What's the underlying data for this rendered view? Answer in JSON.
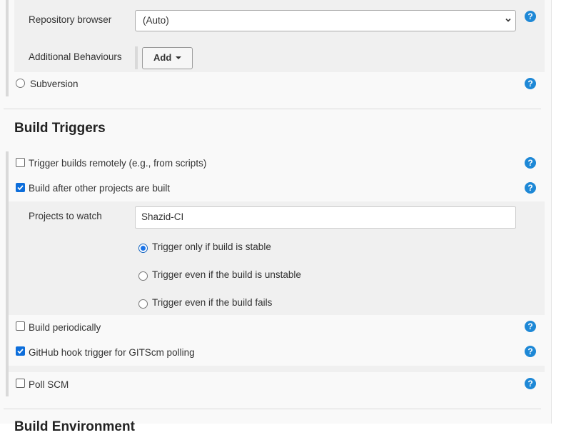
{
  "scm": {
    "repository_browser": {
      "label": "Repository browser",
      "value": "(Auto)"
    },
    "additional_behaviours": {
      "label": "Additional Behaviours",
      "button": "Add"
    },
    "subversion_label": "Subversion"
  },
  "build_triggers": {
    "title": "Build Triggers",
    "remote": "Trigger builds remotely (e.g., from scripts)",
    "after_other": "Build after other projects are built",
    "projects_to_watch": {
      "label": "Projects to watch",
      "value": "Shazid-CI"
    },
    "options": [
      "Trigger only if build is stable",
      "Trigger even if the build is unstable",
      "Trigger even if the build fails"
    ],
    "periodically": "Build periodically",
    "github_hook": "GitHub hook trigger for GITScm polling",
    "poll_scm": "Poll SCM"
  },
  "next_section_partial": "Build Environment",
  "help_glyph": "?",
  "accent_color": "#1e88d6"
}
